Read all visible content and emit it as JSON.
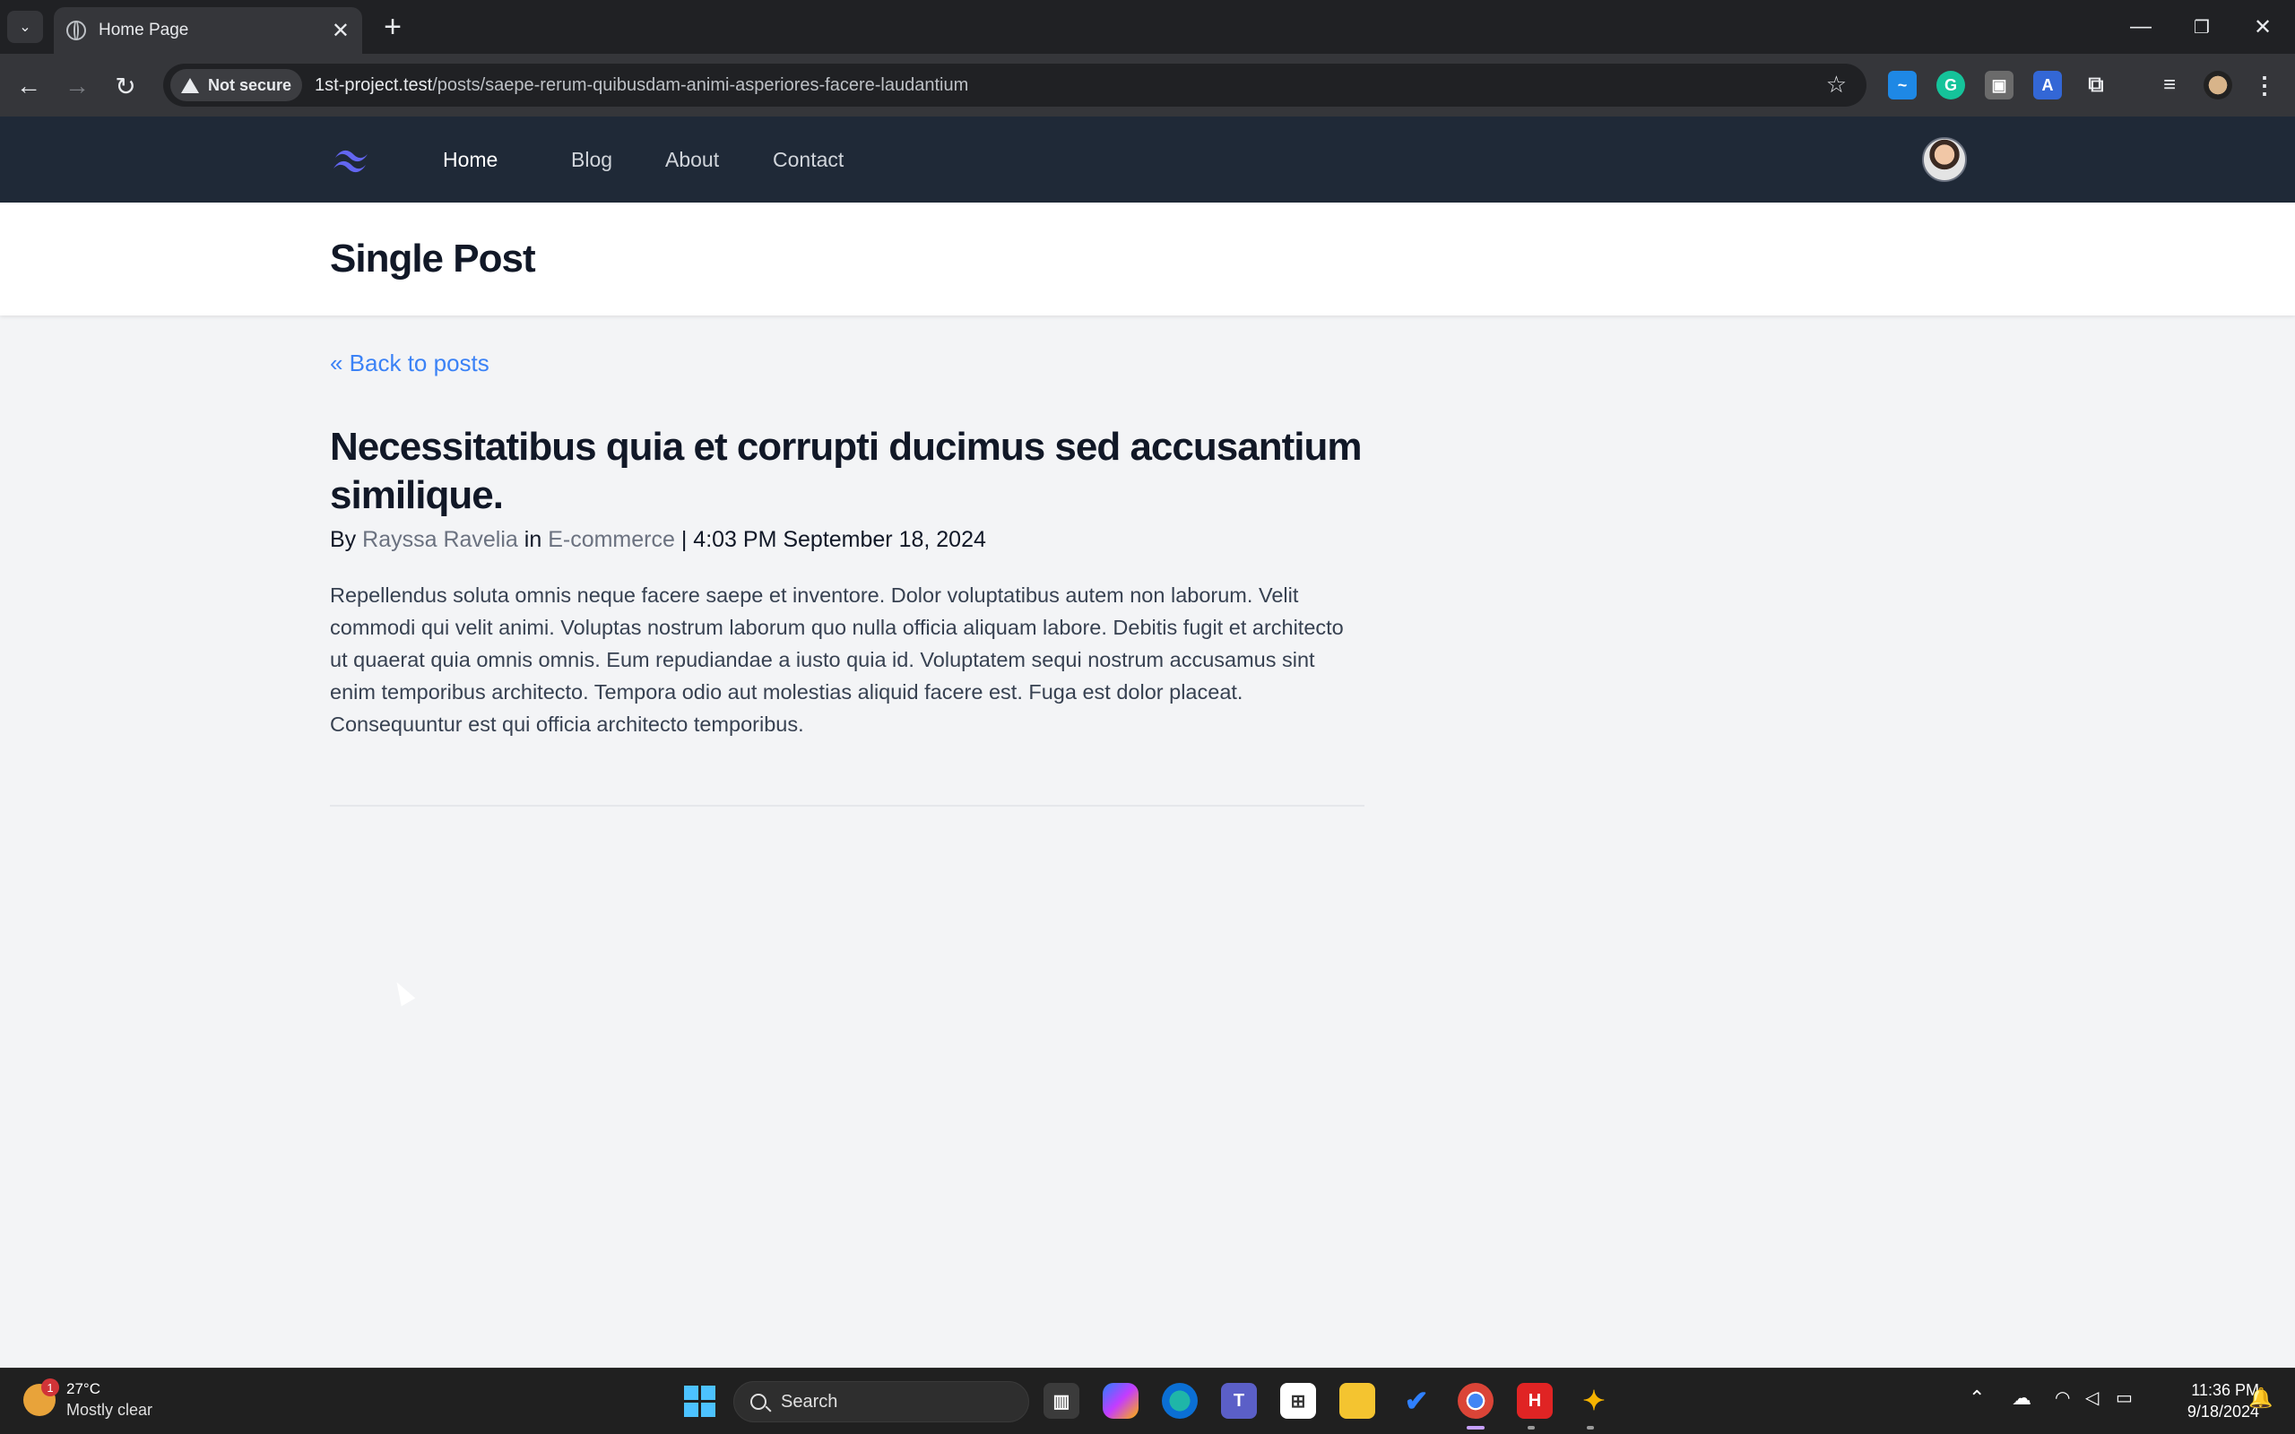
{
  "browser": {
    "tab_title": "Home Page",
    "security_label": "Not secure",
    "url_host": "1st-project.test",
    "url_path": "/posts/saepe-rerum-quibusdam-animi-asperiores-facere-laudantium"
  },
  "nav": {
    "items": [
      {
        "label": "Home"
      },
      {
        "label": "Blog"
      },
      {
        "label": "About"
      },
      {
        "label": "Contact"
      }
    ]
  },
  "header": {
    "title": "Single Post"
  },
  "post": {
    "back_label": "« Back to posts",
    "title": "Necessitatibus quia et corrupti ducimus sed accusantium similique.",
    "by_label": "By",
    "author": "Rayssa Ravelia",
    "in_label": "in",
    "category": "E-commerce",
    "separator": "|",
    "datetime": "4:03 PM September 18, 2024",
    "body": "Repellendus soluta omnis neque facere saepe et inventore. Dolor voluptatibus autem non laborum. Velit commodi qui velit animi. Voluptas nostrum laborum quo nulla officia aliquam labore. Debitis fugit et architecto ut quaerat quia omnis omnis. Eum repudiandae a iusto quia id. Voluptatem sequi nostrum accusamus sint enim temporibus architecto. Tempora odio aut molestias aliquid facere est. Fuga est dolor placeat. Consequuntur est qui officia architecto temporibus."
  },
  "taskbar": {
    "weather_badge": "1",
    "temperature": "27°C",
    "condition": "Mostly clear",
    "search_placeholder": "Search",
    "time": "11:36 PM",
    "date": "9/18/2024"
  },
  "colors": {
    "nav_bg": "#1f2937",
    "link_blue": "#3b82f6",
    "logo": "#6366f1"
  }
}
